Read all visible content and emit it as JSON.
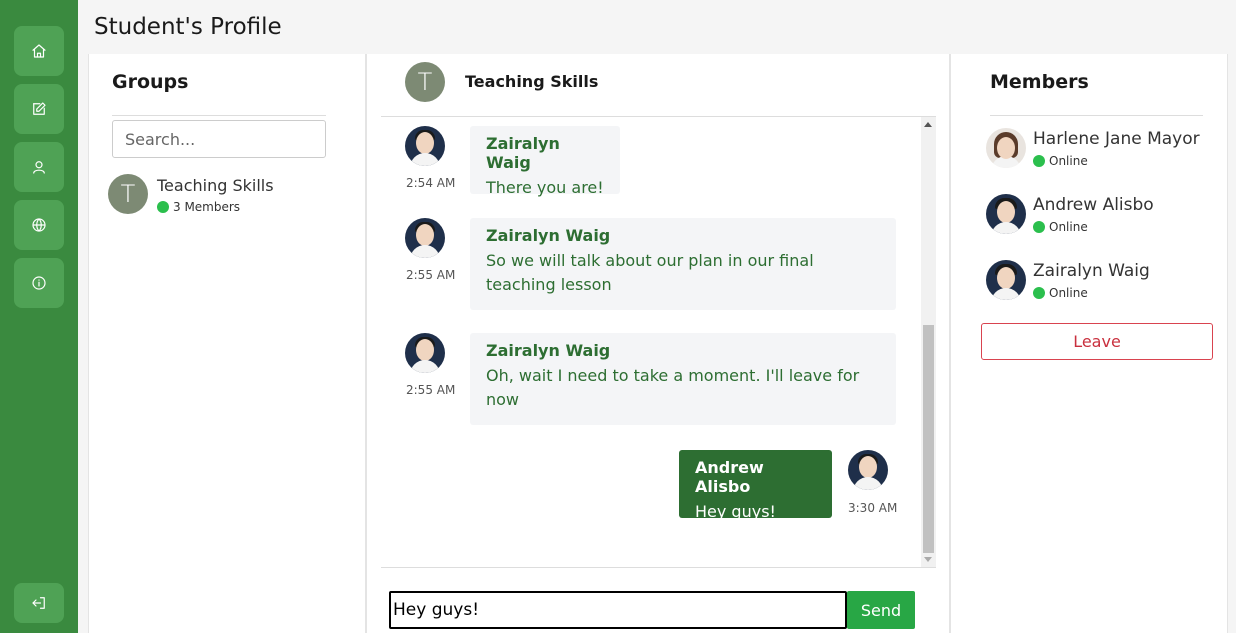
{
  "page": {
    "title": "Student's Profile"
  },
  "sidebar": {
    "items": [
      {
        "name": "home-icon"
      },
      {
        "name": "edit-icon"
      },
      {
        "name": "user-icon"
      },
      {
        "name": "globe-icon"
      },
      {
        "name": "info-icon"
      }
    ],
    "logout": {
      "name": "logout-icon"
    }
  },
  "groups": {
    "heading": "Groups",
    "search_placeholder": "Search...",
    "items": [
      {
        "initial": "T",
        "name": "Teaching Skills",
        "members": "3 Members"
      }
    ]
  },
  "chat": {
    "header": {
      "initial": "T",
      "title": "Teaching Skills"
    },
    "messages": [
      {
        "sender": "Zairalyn Waig",
        "text": "There you are!",
        "time": "2:54 AM",
        "mine": false
      },
      {
        "sender": "Zairalyn Waig",
        "text": "So we will talk about our plan in our final teaching lesson",
        "time": "2:55 AM",
        "mine": false
      },
      {
        "sender": "Zairalyn Waig",
        "text": "Oh, wait I need to take a moment. I'll leave for now",
        "time": "2:55 AM",
        "mine": false
      },
      {
        "sender": "Andrew Alisbo",
        "text": "Hey guys!",
        "time": "3:30 AM",
        "mine": true
      }
    ],
    "composer": {
      "value": "Hey guys!",
      "send_label": "Send"
    }
  },
  "members": {
    "heading": "Members",
    "items": [
      {
        "name": "Harlene Jane Mayor",
        "status": "Online"
      },
      {
        "name": "Andrew Alisbo",
        "status": "Online"
      },
      {
        "name": "Zairalyn Waig",
        "status": "Online"
      }
    ],
    "leave_label": "Leave"
  },
  "colors": {
    "sidebar": "#3a8a3f",
    "accent": "#2d6e32",
    "send": "#28a745",
    "online": "#2bbf4d",
    "leave": "#c9303e"
  }
}
